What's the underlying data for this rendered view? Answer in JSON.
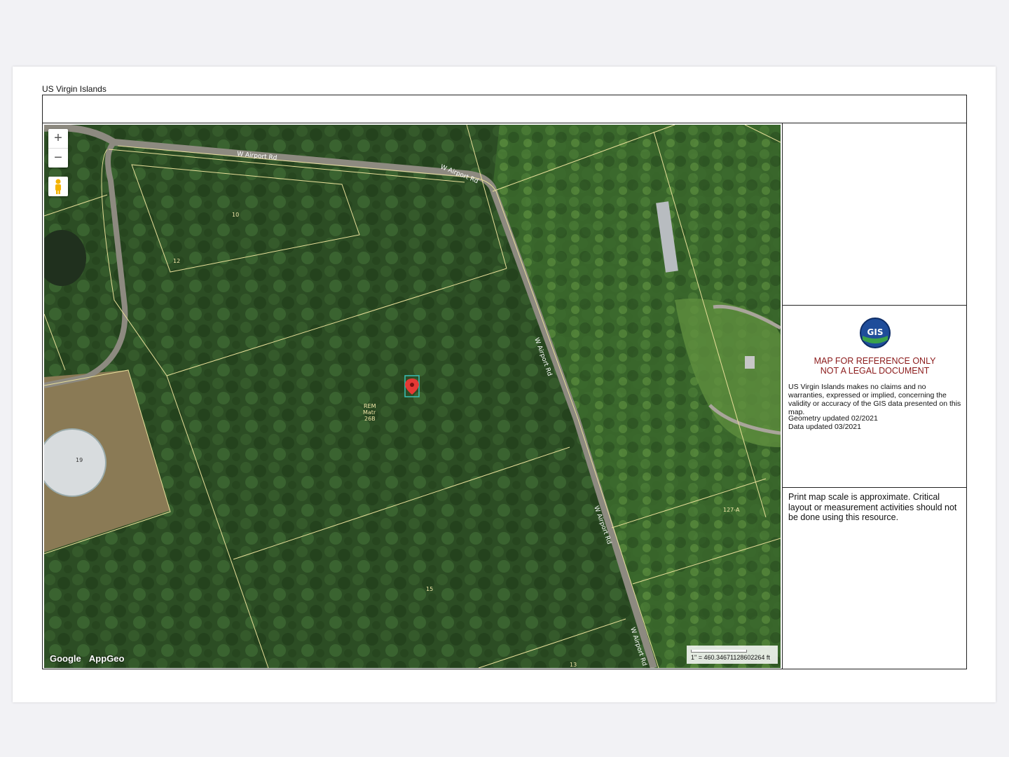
{
  "region_title": "US Virgin Islands",
  "map": {
    "roads": [
      "W Airport Rd",
      "W Airport Rd",
      "W Airport Rd",
      "W Airport Rd",
      "W Airport Rd"
    ],
    "parcels": [
      "10",
      "12",
      "REM Matr 26B",
      "19",
      "15",
      "127-A",
      "13"
    ],
    "parcel_rem": [
      "REM",
      "Matr",
      "26B"
    ],
    "zoom_in": "+",
    "zoom_out": "−",
    "brand_google": "Google",
    "brand_appgeo": "AppGeo",
    "scale_text": "1\" = 460.34671128602264 ft",
    "icons": [
      "plus-icon",
      "minus-icon",
      "pegman-icon",
      "location-pin-icon"
    ]
  },
  "panel": {
    "warning_line1": "MAP FOR REFERENCE ONLY",
    "warning_line2": "NOT A LEGAL DOCUMENT",
    "disclaimer": "US Virgin Islands makes no claims and no warranties, expressed or implied, concerning the validity or accuracy of the GIS data presented on this map.",
    "geometry_updated": "Geometry updated 02/2021",
    "data_updated": "Data updated 03/2021",
    "scale_note": "Print map scale is approximate. Critical layout or measurement activities should not be done using this resource.",
    "logo_text": "GIS"
  },
  "colors": {
    "warning": "#8b1a1a",
    "forest": "#2a4a22",
    "parcel_line": "#e8df9a",
    "pin": "#e53935"
  }
}
